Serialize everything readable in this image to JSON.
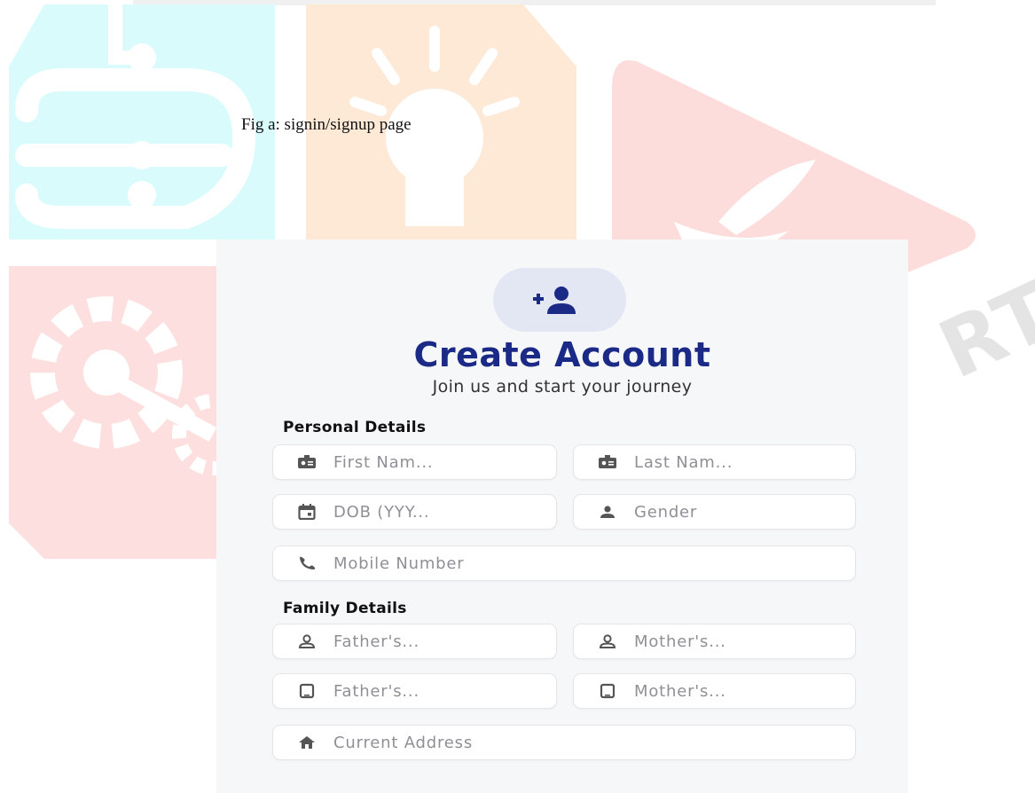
{
  "caption": "Fig a: signin/signup page",
  "watermark_text": "RT",
  "colors": {
    "title": "#1a2a86",
    "avatar_bg": "#e3e6f3",
    "placeholder": "#8e9096",
    "form_bg": "#f6f7f9"
  },
  "header": {
    "avatar_icon": "add-person-icon",
    "title": "Create Account",
    "subtitle": "Join us and start your journey"
  },
  "personal": {
    "heading": "Personal Details",
    "first_name": {
      "icon": "id-card-icon",
      "placeholder": "First Nam..."
    },
    "last_name": {
      "icon": "id-card-icon",
      "placeholder": "Last Nam..."
    },
    "dob": {
      "icon": "calendar-icon",
      "placeholder": "DOB (YYY..."
    },
    "gender": {
      "icon": "person-icon",
      "placeholder": "Gender"
    },
    "mobile": {
      "icon": "phone-icon",
      "placeholder": "Mobile Number"
    }
  },
  "family": {
    "heading": "Family Details",
    "father_name": {
      "icon": "person-outline-icon",
      "placeholder": "Father's..."
    },
    "mother_name": {
      "icon": "person-outline-icon",
      "placeholder": "Mother's..."
    },
    "father_mobile": {
      "icon": "tablet-icon",
      "placeholder": "Father's..."
    },
    "mother_mobile": {
      "icon": "tablet-icon",
      "placeholder": "Mother's..."
    },
    "address": {
      "icon": "home-icon",
      "placeholder": "Current Address"
    }
  }
}
